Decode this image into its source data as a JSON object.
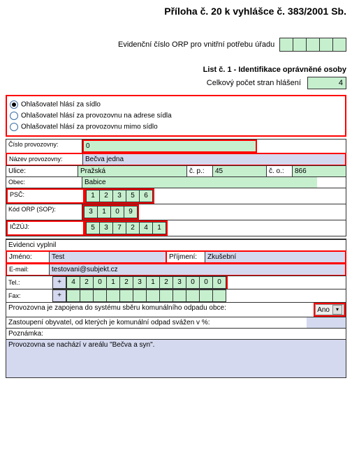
{
  "header": {
    "title": "Příloha č. 20 k vyhlášce č. 383/2001 Sb."
  },
  "orp": {
    "label": "Evidenční číslo ORP pro vnitřní potřebu úřadu"
  },
  "list_title": "List č. 1 - Identifikace oprávněné osoby",
  "total": {
    "label": "Celkový počet stran hlášení",
    "value": "4"
  },
  "radios": {
    "r1": "Ohlašovatel hlásí za sídlo",
    "r2": "Ohlašovatel hlásí za provozovnu na adrese sídla",
    "r3": "Ohlašovatel hlásí za provozovnu mimo sídlo"
  },
  "cislo_prov": {
    "label": "Číslo provozovny:",
    "value": "0"
  },
  "nazev_prov": {
    "label": "Název provozovny:",
    "value": "Bečva jedna"
  },
  "ulice": {
    "label": "Ulice:",
    "value": "Pražská",
    "cp_label": "č. p.:",
    "cp": "45",
    "co_label": "č. o.:",
    "co": "866"
  },
  "obec": {
    "label": "Obec:",
    "value": "Babice"
  },
  "psc": {
    "label": "PSČ:",
    "d": [
      "1",
      "2",
      "3",
      "5",
      "6"
    ]
  },
  "kod_orp": {
    "label": "Kód ORP (SOP):",
    "d": [
      "3",
      "1",
      "0",
      "9"
    ]
  },
  "iczuj": {
    "label": "IČZÚJ:",
    "d": [
      "5",
      "3",
      "7",
      "2",
      "4",
      "1"
    ]
  },
  "evidenci": "Evidenci vyplnil",
  "jmeno": {
    "label": "Jméno:",
    "value": "Test",
    "prijmeni_label": "Příjmení:",
    "prijmeni": "Zkušební"
  },
  "email": {
    "label": "E-mail:",
    "value": "testovani@subjekt.cz"
  },
  "tel": {
    "label": "Tel.:",
    "plus": "+",
    "d": [
      "4",
      "2",
      "0",
      "1",
      "2",
      "3",
      "1",
      "2",
      "3",
      "0",
      "0",
      "0"
    ]
  },
  "fax": {
    "label": "Fax:",
    "plus": "+"
  },
  "zapojena": {
    "label": "Provozovna je zapojena do systému sběru komunálního odpadu obce:",
    "value": "Ano"
  },
  "zastoupeni": {
    "label": "Zastoupení obyvatel, od kterých je komunální odpad svážen v %:"
  },
  "poznamka": {
    "label": "Poznámka:",
    "text": "Provozovna se nachází v areálu \"Bečva a syn\"."
  }
}
